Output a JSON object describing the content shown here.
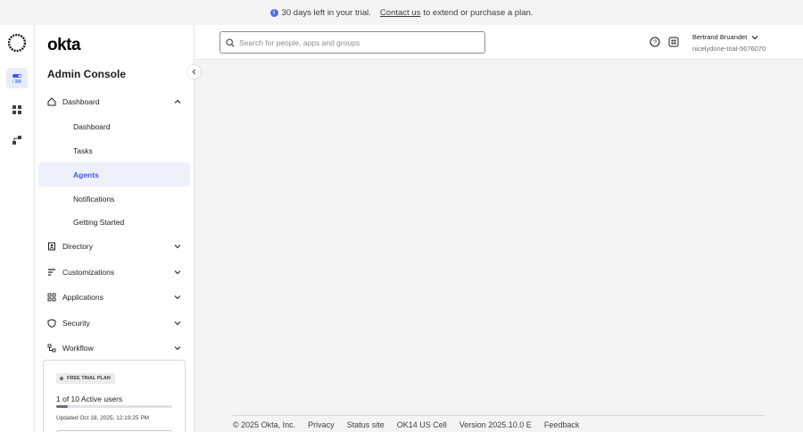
{
  "banner": {
    "trial_text": "30 days left in your trial.",
    "contact_link": "Contact us",
    "contact_suffix": "to extend or purchase a plan."
  },
  "brand": {
    "logo_text": "okta",
    "console_title": "Admin Console"
  },
  "search": {
    "placeholder": "Search for people, apps and groups",
    "value": ""
  },
  "user": {
    "name": "Bertrand Bruandet",
    "org": "nicelydone-trial-5676070"
  },
  "nav": {
    "dashboard": {
      "label": "Dashboard",
      "expanded": true,
      "items": [
        {
          "label": "Dashboard"
        },
        {
          "label": "Tasks"
        },
        {
          "label": "Agents",
          "active": true
        },
        {
          "label": "Notifications"
        },
        {
          "label": "Getting Started"
        }
      ]
    },
    "directory": {
      "label": "Directory"
    },
    "customizations": {
      "label": "Customizations"
    },
    "applications": {
      "label": "Applications"
    },
    "security": {
      "label": "Security"
    },
    "workflow": {
      "label": "Workflow"
    }
  },
  "plan": {
    "badge": "FREE TRIAL PLAN",
    "users": "1 of 10 Active users",
    "users_fraction": 0.1,
    "updated": "Updated Oct 18, 2025, 12:19:25 PM"
  },
  "footer": {
    "copyright": "© 2025 Okta, Inc.",
    "privacy": "Privacy",
    "status": "Status site",
    "cell": "OK14 US Cell",
    "version": "Version 2025.10.0 E",
    "feedback": "Feedback"
  },
  "colors": {
    "accent": "#3f59e4",
    "active_bg": "#eef0fb",
    "info": "#546be7"
  }
}
